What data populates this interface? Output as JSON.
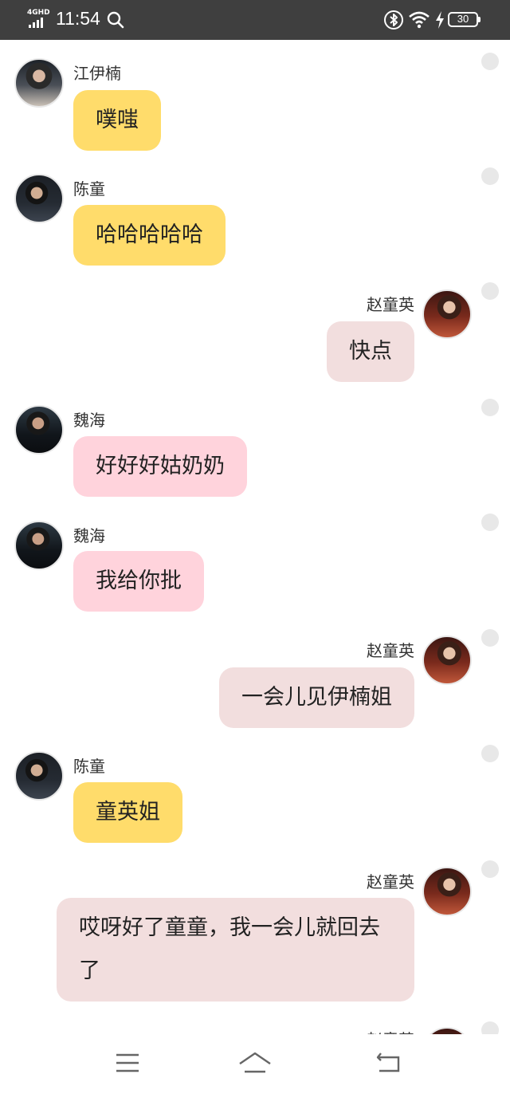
{
  "status_bar": {
    "network": "4GHD",
    "time": "11:54",
    "battery": "30",
    "icons": [
      "search-icon",
      "bluetooth-icon",
      "wifi-icon",
      "charging-icon",
      "battery-icon"
    ]
  },
  "messages": [
    {
      "sender": "江伊楠",
      "text": "噗嗤"
    },
    {
      "sender": "陈童",
      "text": "哈哈哈哈哈"
    },
    {
      "sender": "赵童英",
      "text": "快点"
    },
    {
      "sender": "魏海",
      "text": "好好好姑奶奶"
    },
    {
      "sender": "魏海",
      "text": "我给你批"
    },
    {
      "sender": "赵童英",
      "text": "一会儿见伊楠姐"
    },
    {
      "sender": "陈童",
      "text": "童英姐"
    },
    {
      "sender": "赵童英",
      "text": "哎呀好了童童，我一会儿就回去了"
    },
    {
      "sender": "赵童英",
      "text": ""
    }
  ],
  "colors": {
    "status_bar_bg": "#3f3f3f",
    "bubble_yellow": "#ffdc6b",
    "bubble_pink": "#ffd3dc",
    "bubble_mine": "#f2dede"
  },
  "nav_bar": {
    "icons": [
      "menu-icon",
      "home-icon",
      "back-icon"
    ]
  }
}
